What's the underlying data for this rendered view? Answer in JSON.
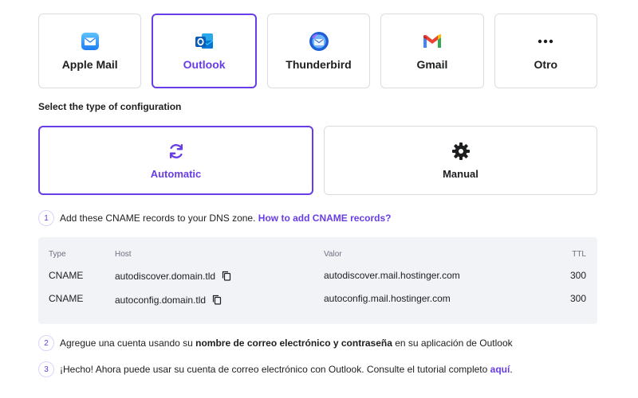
{
  "clients": [
    {
      "label": "Apple Mail",
      "icon": "apple-mail-icon",
      "selected": false
    },
    {
      "label": "Outlook",
      "icon": "outlook-icon",
      "selected": true
    },
    {
      "label": "Thunderbird",
      "icon": "thunderbird-icon",
      "selected": false
    },
    {
      "label": "Gmail",
      "icon": "gmail-icon",
      "selected": false
    },
    {
      "label": "Otro",
      "icon": "more-icon",
      "selected": false
    }
  ],
  "config_section": {
    "title": "Select the type of configuration",
    "options": [
      {
        "label": "Automatic",
        "icon": "sync-icon",
        "selected": true
      },
      {
        "label": "Manual",
        "icon": "gear-icon",
        "selected": false
      }
    ]
  },
  "steps": {
    "step1": {
      "number": "1",
      "text": "Add these CNAME records to your DNS zone. ",
      "link": "How to add CNAME records?"
    },
    "step2": {
      "number": "2",
      "pre": "Agregue una cuenta usando su ",
      "bold": "nombre de correo electrónico y contraseña",
      "post": " en su aplicación de Outlook"
    },
    "step3": {
      "number": "3",
      "pre": "¡Hecho! Ahora puede usar su cuenta de correo electrónico con Outlook. Consulte el tutorial completo ",
      "link": "aquí",
      "post": "."
    }
  },
  "dns_table": {
    "headers": {
      "type": "Type",
      "host": "Host",
      "value": "Valor",
      "ttl": "TTL"
    },
    "rows": [
      {
        "type": "CNAME",
        "host": "autodiscover.domain.tld",
        "value": "autodiscover.mail.hostinger.com",
        "ttl": "300"
      },
      {
        "type": "CNAME",
        "host": "autoconfig.domain.tld",
        "value": "autoconfig.mail.hostinger.com",
        "ttl": "300"
      }
    ]
  },
  "colors": {
    "accent": "#673de6",
    "border": "#dadce0",
    "table_bg": "#f2f3f6",
    "text": "#1d1e20",
    "muted": "#6d7081"
  }
}
